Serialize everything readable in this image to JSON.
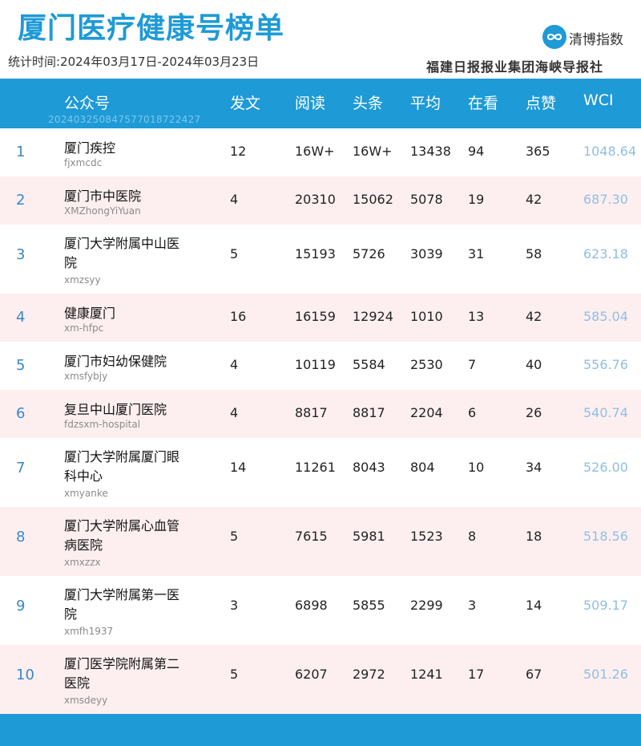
{
  "header": {
    "title": "厦门医疗健康号榜单",
    "period": "统计时间:2024年03月17日-2024年03月23日",
    "logo_text": "清博指数",
    "publisher": "福建日报报业集团海峡导报社"
  },
  "columns": {
    "account": "公众号",
    "posts": "发文",
    "reads": "阅读",
    "headline": "头条",
    "average": "平均",
    "watching": "在看",
    "likes": "点赞",
    "wci": "WCI"
  },
  "watermark": "20240325084757701872242​7",
  "rows": [
    {
      "rank": "1",
      "name": "厦门疾控",
      "account": "fjxmcdc",
      "posts": "12",
      "reads": "16W+",
      "headline": "16W+",
      "average": "13438",
      "watching": "94",
      "likes": "365",
      "wci": "1048.64"
    },
    {
      "rank": "2",
      "name": "厦门市中医院",
      "account": "XMZhongYiYuan",
      "posts": "4",
      "reads": "20310",
      "headline": "15062",
      "average": "5078",
      "watching": "19",
      "likes": "42",
      "wci": "687.30"
    },
    {
      "rank": "3",
      "name": "厦门大学附属中山医院",
      "account": "xmzsyy",
      "posts": "5",
      "reads": "15193",
      "headline": "5726",
      "average": "3039",
      "watching": "31",
      "likes": "58",
      "wci": "623.18"
    },
    {
      "rank": "4",
      "name": "健康厦门",
      "account": "xm-hfpc",
      "posts": "16",
      "reads": "16159",
      "headline": "12924",
      "average": "1010",
      "watching": "13",
      "likes": "42",
      "wci": "585.04"
    },
    {
      "rank": "5",
      "name": "厦门市妇幼保健院",
      "account": "xmsfybjy",
      "posts": "4",
      "reads": "10119",
      "headline": "5584",
      "average": "2530",
      "watching": "7",
      "likes": "40",
      "wci": "556.76"
    },
    {
      "rank": "6",
      "name": "复旦中山厦门医院",
      "account": "fdzsxm-hospital",
      "posts": "4",
      "reads": "8817",
      "headline": "8817",
      "average": "2204",
      "watching": "6",
      "likes": "26",
      "wci": "540.74"
    },
    {
      "rank": "7",
      "name": "厦门大学附属厦门眼科中心",
      "account": "xmyanke",
      "posts": "14",
      "reads": "11261",
      "headline": "8043",
      "average": "804",
      "watching": "10",
      "likes": "34",
      "wci": "526.00"
    },
    {
      "rank": "8",
      "name": "厦门大学附属心血管病医院",
      "account": "xmxzzx",
      "posts": "5",
      "reads": "7615",
      "headline": "5981",
      "average": "1523",
      "watching": "8",
      "likes": "18",
      "wci": "518.56"
    },
    {
      "rank": "9",
      "name": "厦门大学附属第一医院",
      "account": "xmfh1937",
      "posts": "3",
      "reads": "6898",
      "headline": "5855",
      "average": "2299",
      "watching": "3",
      "likes": "14",
      "wci": "509.17"
    },
    {
      "rank": "10",
      "name": "厦门医学院附属第二医院",
      "account": "xmsdeyy",
      "posts": "5",
      "reads": "6207",
      "headline": "2972",
      "average": "1241",
      "watching": "17",
      "likes": "67",
      "wci": "501.26"
    }
  ]
}
